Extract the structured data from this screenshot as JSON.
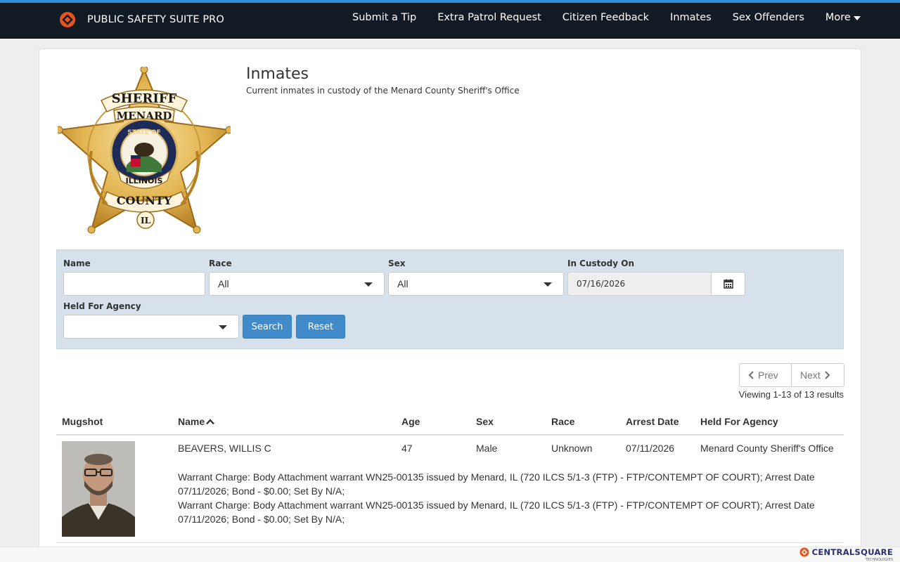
{
  "navbar": {
    "brand": "PUBLIC SAFETY SUITE PRO",
    "items": [
      {
        "label": "Submit a Tip"
      },
      {
        "label": "Extra Patrol Request"
      },
      {
        "label": "Citizen Feedback"
      },
      {
        "label": "Inmates"
      },
      {
        "label": "Sex Offenders"
      },
      {
        "label": "More"
      }
    ]
  },
  "header": {
    "title": "Inmates",
    "subtitle": "Current inmates in custody of the Menard County Sheriff's Office"
  },
  "badge": {
    "top_text": "SHERIFF",
    "county": "MENARD",
    "ring_text": "STATE OF",
    "state": "ILLINOIS",
    "bottom_text": "COUNTY",
    "tip": "IL"
  },
  "filters": {
    "name_label": "Name",
    "name_value": "",
    "race_label": "Race",
    "race_value": "All",
    "sex_label": "Sex",
    "sex_value": "All",
    "custody_label": "In Custody On",
    "custody_value": "07/16/2026",
    "agency_label": "Held For Agency",
    "agency_value": "",
    "search_button": "Search",
    "reset_button": "Reset"
  },
  "pagination": {
    "prev": "Prev",
    "next": "Next",
    "viewing": "Viewing 1-13 of 13 results"
  },
  "table": {
    "columns": [
      "Mugshot",
      "Name",
      "Age",
      "Sex",
      "Race",
      "Arrest Date",
      "Held For Agency"
    ],
    "rows": [
      {
        "name": "BEAVERS, WILLIS C",
        "age": "47",
        "sex": "Male",
        "race": "Unknown",
        "arrest_date": "07/11/2026",
        "agency": "Menard County Sheriff's Office",
        "charges": [
          "Warrant Charge: Body Attachment warrant WN25-00135 issued by Menard, IL (720 ILCS 5/1-3 (FTP) - FTP/CONTEMPT OF COURT); Arrest Date 07/11/2026; Bond - $0.00; Set By N/A;",
          "Warrant Charge: Body Attachment warrant WN25-00135 issued by Menard, IL (720 ILCS 5/1-3 (FTP) - FTP/CONTEMPT OF COURT); Arrest Date 07/11/2026; Bond - $0.00; Set By N/A;"
        ]
      }
    ]
  },
  "footer": {
    "logo_text": "CENTRALSQUARE",
    "logo_sub": "TECHNOLOGIES"
  },
  "colors": {
    "navbar_bg": "#121a24",
    "navbar_accent": "#2f8fdc",
    "brand_orange": "#e8541e",
    "filter_bg": "#d6e1ec",
    "button_blue": "#428bca"
  }
}
